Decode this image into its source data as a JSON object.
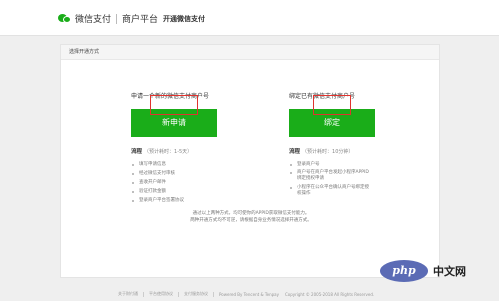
{
  "header": {
    "logo_text": "微信支付",
    "platform": "商户平台",
    "subtitle": "开通微信支付"
  },
  "panel": {
    "title": "选择开通方式",
    "left": {
      "heading": "申请一个新的微信支付商户号",
      "button_label": "新申请",
      "process_label": "流程",
      "process_estimate": "（预计耗时：1-5天）",
      "steps": [
        "填写申请信息",
        "经过微信支付审核",
        "查收开户邮件",
        "验证打款金额",
        "登录商户平台签署协议"
      ]
    },
    "right": {
      "heading": "绑定已有微信支付商户号",
      "button_label": "绑定",
      "process_label": "流程",
      "process_estimate": "（预计耗时：10分钟）",
      "steps": [
        "登录商户号",
        "商户号在商户平台发起小程序APPID绑定授权申请",
        "小程序在公众平台确认商户号绑定授权操作"
      ]
    },
    "note_line1": "通过以上两种方式，均可使你的APPID获取微信支付能力。",
    "note_line2": "两种开通方式均不可逆，请根据自身业务情况选择开通方式。"
  },
  "footer": {
    "links": [
      "关于财付通",
      "平台使用协议",
      "支付服务协议"
    ],
    "powered": "Powered By Tencent & Tenpay",
    "copyright": "Copyright © 2005-2018 All Rights Reserved."
  },
  "watermark": {
    "badge": "php",
    "text": "中文网"
  },
  "colors": {
    "accent_green": "#1aad19",
    "highlight_red": "#e0332e",
    "watermark_blue": "#5b6bb5"
  }
}
